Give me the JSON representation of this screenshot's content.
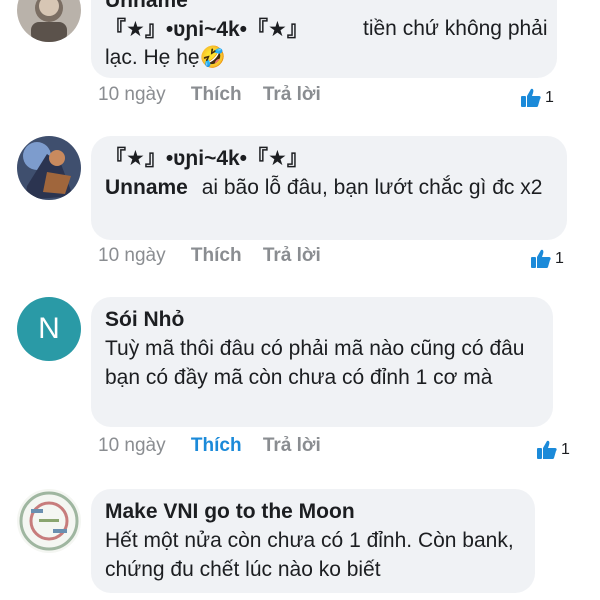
{
  "comments": [
    {
      "author": "Unname",
      "tag_line": "『★』•ʋɲi~4k•『★』",
      "text": "tiền chứ không phải lạc. Hẹ hẹ🤣",
      "time": "10 ngày",
      "like_label": "Thích",
      "reply_label": "Trả lời",
      "like_count": "1",
      "liked": false
    },
    {
      "author": "Unname",
      "tag_line": "『★』•ʋɲi~4k•『★』",
      "text": "ai bão lỗ đâu, bạn lướt chắc gì đc x2",
      "time": "10 ngày",
      "like_label": "Thích",
      "reply_label": "Trả lời",
      "like_count": "1",
      "liked": false
    },
    {
      "author": "Sói Nhỏ",
      "avatar_letter": "N",
      "text": "Tuỳ mã thôi đâu có phải mã nào cũng có đâu bạn có đầy mã còn chưa có đỉnh 1 cơ mà",
      "time": "10 ngày",
      "like_label": "Thích",
      "reply_label": "Trả lời",
      "like_count": "1",
      "liked": true
    },
    {
      "author": "Make VNI go to the Moon",
      "text": "Hết một nửa còn chưa có 1 đỉnh. Còn bank, chứng đu chết lúc nào ko biết"
    }
  ],
  "colors": {
    "bubble_bg": "#f0f2f5",
    "meta_gray": "#8a8d91",
    "like_blue": "#1b8ad9",
    "avatar_teal": "#2a9aa6"
  }
}
